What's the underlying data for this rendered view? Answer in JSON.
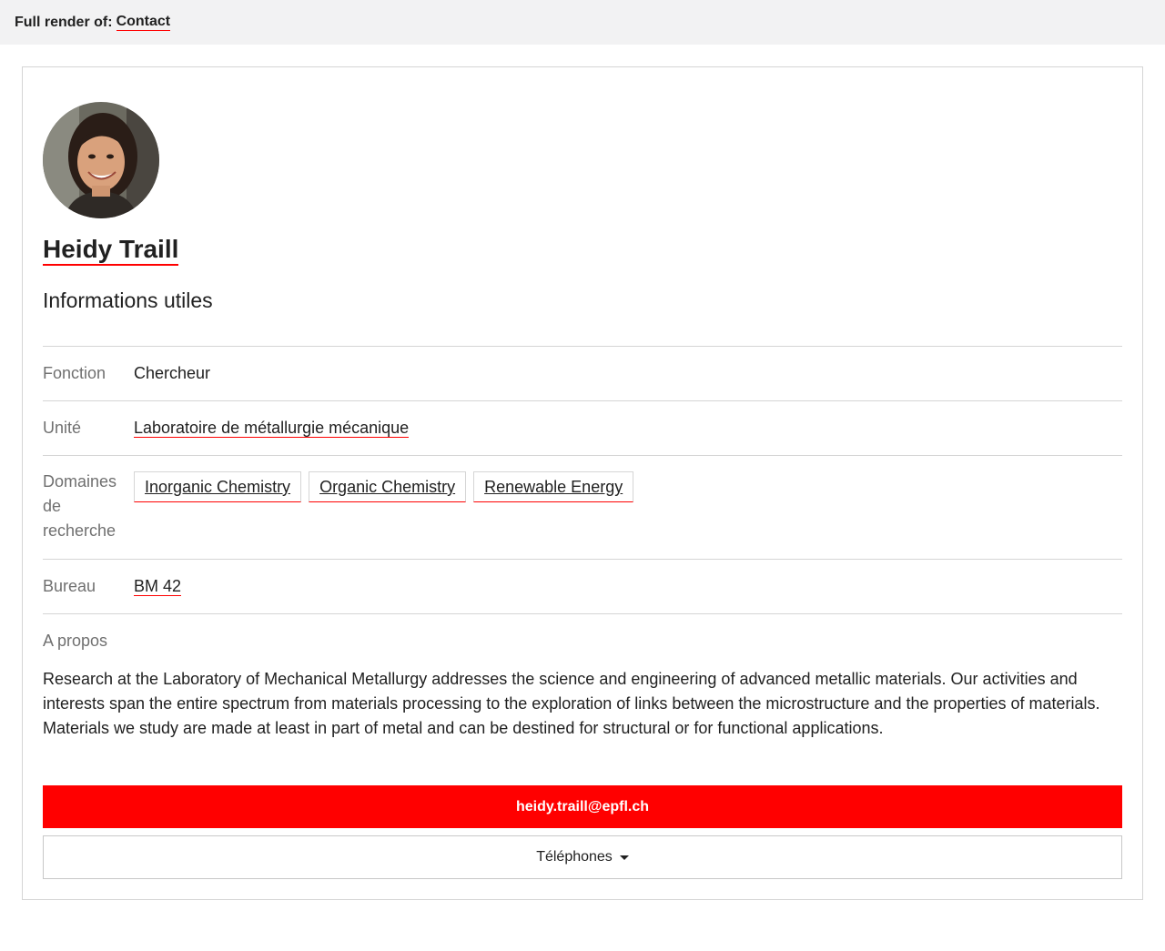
{
  "topbar": {
    "prefix": "Full render of:",
    "link": "Contact"
  },
  "profile": {
    "name": "Heidy Traill",
    "section_title": "Informations utiles",
    "fields": {
      "function_label": "Fonction",
      "function_value": "Chercheur",
      "unit_label": "Unité",
      "unit_value": "Laboratoire de métallurgie mécanique",
      "domains_label": "Domaines de recherche",
      "domains": [
        "Inorganic Chemistry",
        "Organic Chemistry",
        "Renewable Energy"
      ],
      "office_label": "Bureau",
      "office_value": "BM 42"
    },
    "about_label": "A propos",
    "about_text": "Research at the Laboratory of Mechanical Metallurgy addresses the science and engineering of advanced metallic materials. Our activities and interests span the entire spectrum from materials processing to the exploration of links between the microstructure and the properties of materials. Materials we study are made at least in part of metal and can be destined for structural or for functional applications.",
    "email": "heidy.traill@epfl.ch",
    "phones_label": "Téléphones"
  },
  "colors": {
    "accent": "#ff0000",
    "border": "#d5d5d5",
    "muted_text": "#707070"
  },
  "icons": [
    "avatar-photo",
    "caret-down-icon"
  ]
}
